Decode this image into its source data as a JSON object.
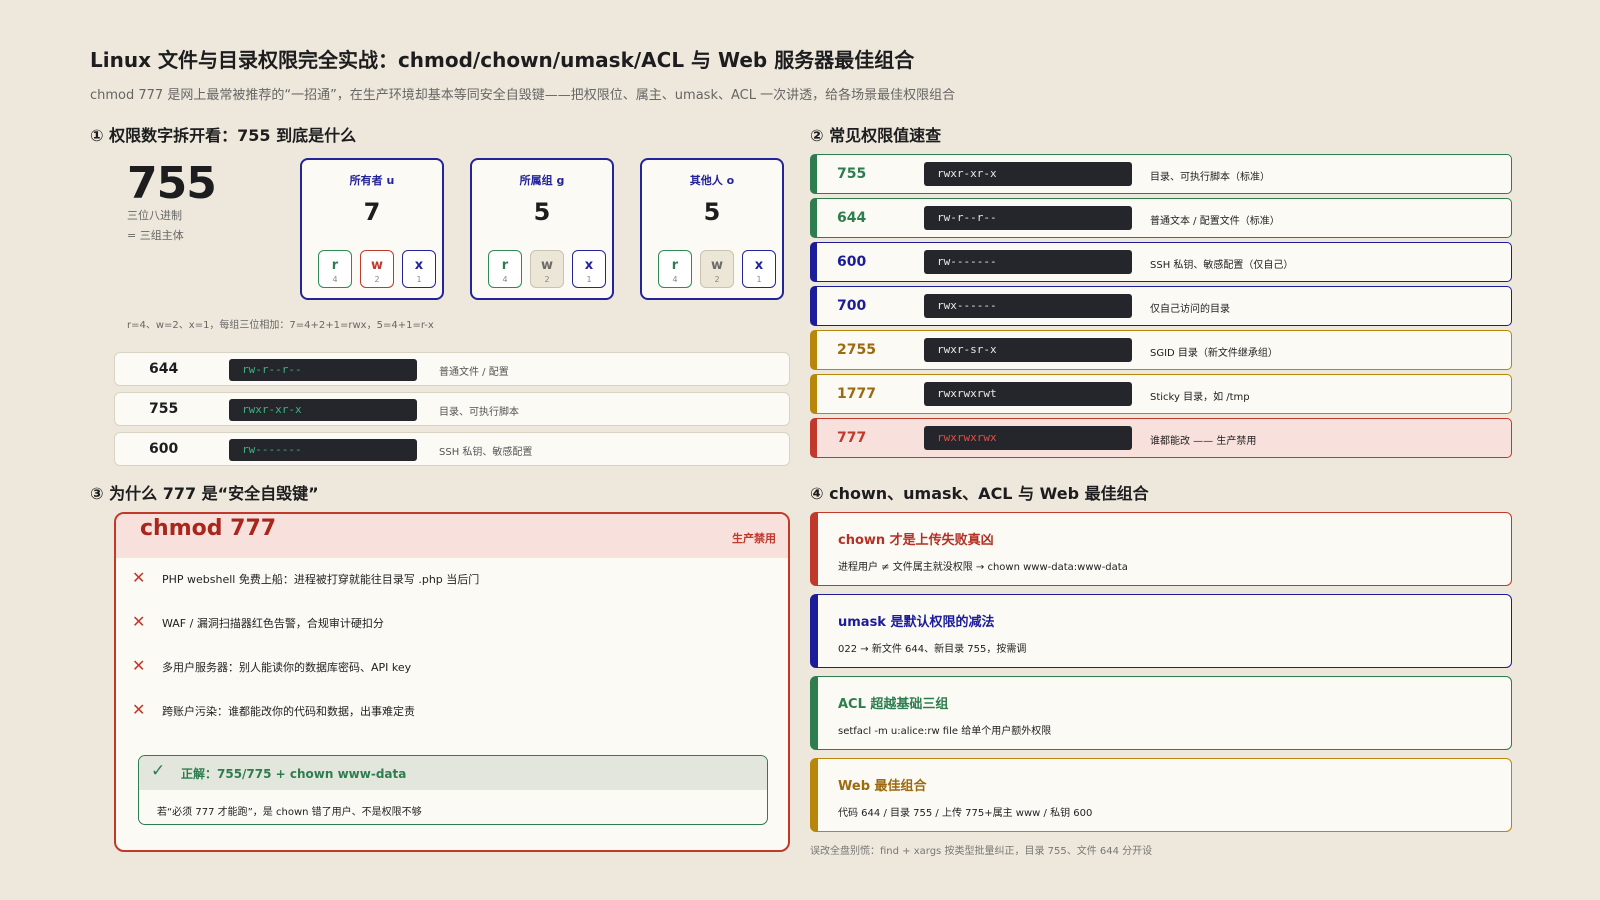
{
  "header": {
    "title": "Linux 文件与目录权限完全实战：chmod/chown/umask/ACL 与 Web 服务器最佳组合",
    "subtitle": "chmod 777 是网上最常被推荐的“一招通”，在生产环境却基本等同安全自毁键——把权限位、属主、umask、ACL 一次讲透，给各场景最佳权限组合"
  },
  "section1": {
    "heading": "① 权限数字拆开看：755 到底是什么",
    "big_number": "755",
    "caption_line1": "三位八进制",
    "caption_line2": "= 三组主体",
    "groups": [
      {
        "label": "所有者 u",
        "digit": "7",
        "bits": [
          {
            "l": "r",
            "v": "4",
            "on": true
          },
          {
            "l": "w",
            "v": "2",
            "on": true
          },
          {
            "l": "x",
            "v": "1",
            "on": true
          }
        ]
      },
      {
        "label": "所属组 g",
        "digit": "5",
        "bits": [
          {
            "l": "r",
            "v": "4",
            "on": true
          },
          {
            "l": "w",
            "v": "2",
            "on": false
          },
          {
            "l": "x",
            "v": "1",
            "on": true
          }
        ]
      },
      {
        "label": "其他人 o",
        "digit": "5",
        "bits": [
          {
            "l": "r",
            "v": "4",
            "on": true
          },
          {
            "l": "w",
            "v": "2",
            "on": false
          },
          {
            "l": "x",
            "v": "1",
            "on": true
          }
        ]
      }
    ],
    "formula": "r=4、w=2、x=1，每组三位相加：7=4+2+1=rwx，5=4+1=r-x",
    "rows": [
      {
        "value": "644",
        "symbolic": "rw-r--r--",
        "desc": "普通文件 / 配置"
      },
      {
        "value": "755",
        "symbolic": "rwxr-xr-x",
        "desc": "目录、可执行脚本"
      },
      {
        "value": "600",
        "symbolic": "rw-------",
        "desc": "SSH 私钥、敏感配置"
      }
    ]
  },
  "section2": {
    "heading": "② 常见权限值速查",
    "rows": [
      {
        "value": "755",
        "symbolic": "rwxr-xr-x",
        "desc": "目录、可执行脚本（标准）",
        "tone": "green"
      },
      {
        "value": "644",
        "symbolic": "rw-r--r--",
        "desc": "普通文本 / 配置文件（标准）",
        "tone": "green"
      },
      {
        "value": "600",
        "symbolic": "rw-------",
        "desc": "SSH 私钥、敏感配置（仅自己）",
        "tone": "blue"
      },
      {
        "value": "700",
        "symbolic": "rwx------",
        "desc": "仅自己访问的目录",
        "tone": "blue"
      },
      {
        "value": "2755",
        "symbolic": "rwxr-sr-x",
        "desc": "SGID 目录（新文件继承组）",
        "tone": "gold"
      },
      {
        "value": "1777",
        "symbolic": "rwxrwxrwt",
        "desc": "Sticky 目录，如 /tmp",
        "tone": "gold"
      },
      {
        "value": "777",
        "symbolic": "rwxrwxrwx",
        "desc": "谁都能改 —— 生产禁用",
        "tone": "red"
      }
    ]
  },
  "section3": {
    "heading": "③ 为什么 777 是“安全自毁键”",
    "panel_title": "chmod 777",
    "panel_tag": "生产禁用",
    "risks": [
      "PHP webshell 免费上船：进程被打穿就能往目录写 .php 当后门",
      "WAF / 漏洞扫描器红色告警，合规审计硬扣分",
      "多用户服务器：别人能读你的数据库密码、API key",
      "跨账户污染：谁都能改你的代码和数据，出事难定责"
    ],
    "fix_title": "正解：755/775 + chown www-data",
    "fix_body": "若“必须 777 才能跑”，是 chown 错了用户、不是权限不够"
  },
  "section4": {
    "heading": "④ chown、umask、ACL 与 Web 最佳组合",
    "cards": [
      {
        "title": "chown 才是上传失败真凶",
        "body": "进程用户 ≠ 文件属主就没权限 → chown www-data:www-data",
        "tone": "red"
      },
      {
        "title": "umask 是默认权限的减法",
        "body": "022 → 新文件 644、新目录 755，按需调",
        "tone": "blue"
      },
      {
        "title": "ACL 超越基础三组",
        "body": "setfacl -m u:alice:rw file 给单个用户额外权限",
        "tone": "green"
      },
      {
        "title": "Web 最佳组合",
        "body": "代码 644 / 目录 755 / 上传 775+属主 www / 私钥 600",
        "tone": "gold"
      }
    ],
    "footnote": "误改全盘别慌：find + xargs 按类型批量纠正，目录 755、文件 644 分开设"
  }
}
